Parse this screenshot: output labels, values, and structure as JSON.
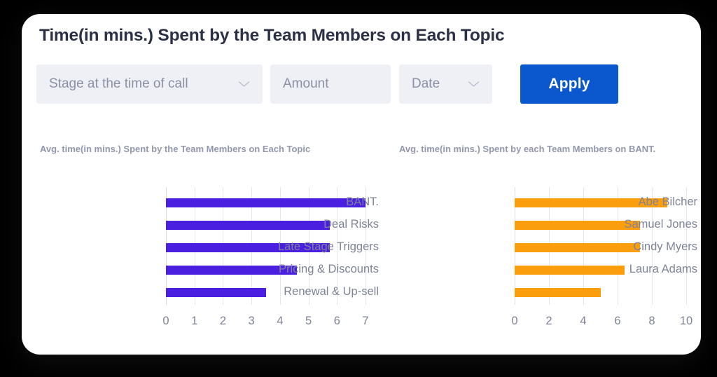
{
  "card": {
    "title": "Time(in mins.) Spent by the Team Members on Each Topic"
  },
  "filters": {
    "stage": {
      "label": "Stage at the time of call",
      "icon": "chevron-down-icon"
    },
    "amount": {
      "label": "Amount"
    },
    "date": {
      "label": "Date",
      "icon": "chevron-down-icon"
    },
    "apply_label": "Apply"
  },
  "colors": {
    "accent_blue": "#0b57ce",
    "bar_purple": "#4a1fe0",
    "bar_orange": "#fb9e0e",
    "field_bg": "#eef0f5",
    "title": "#2c3045",
    "muted_text": "#7e8398",
    "subtitle": "#9397ad",
    "gridline": "#e4e6ec",
    "card_bg": "#ffffff",
    "page_bg": "#000000"
  },
  "chart_data": [
    {
      "type": "bar",
      "orientation": "horizontal",
      "id": "avg-time-by-topic",
      "title": "Avg. time(in mins.) Spent by the Team Members on Each Topic",
      "categories": [
        "BANT.",
        "Deal Risks",
        "Late Stage Triggers",
        "Pricing & Discounts",
        "Renewal & Up-sell"
      ],
      "values": [
        7.0,
        5.75,
        5.75,
        4.6,
        3.5
      ],
      "series": [
        {
          "name": "Avg. time (mins)",
          "values": [
            7.0,
            5.75,
            5.75,
            4.6,
            3.5
          ],
          "color": "#4a1fe0"
        }
      ],
      "xlabel": "",
      "ylabel": "",
      "xlim": [
        0,
        7
      ],
      "xticks": [
        0,
        1,
        2,
        3,
        4,
        5,
        6,
        7
      ],
      "xticklabels": [
        "0",
        "1",
        "2",
        "3",
        "4",
        "5",
        "6",
        "7"
      ],
      "grid": true,
      "legend": false
    },
    {
      "type": "bar",
      "orientation": "horizontal",
      "id": "avg-time-on-bant",
      "title": "Avg. time(in mins.) Spent by each Team Members on BANT.",
      "categories": [
        "Abe Bilcher",
        "Samuel Jones",
        "Cindy Myers",
        "Laura Adams",
        ""
      ],
      "values": [
        8.9,
        7.3,
        7.3,
        6.4,
        5.0
      ],
      "series": [
        {
          "name": "Avg. time (mins)",
          "values": [
            8.9,
            7.3,
            7.3,
            6.4,
            5.0
          ],
          "color": "#fb9e0e"
        }
      ],
      "xlabel": "",
      "ylabel": "",
      "xlim": [
        0,
        10
      ],
      "xticks": [
        0,
        2,
        4,
        6,
        8,
        10
      ],
      "xticklabels": [
        "0",
        "2",
        "4",
        "6",
        "8",
        "10"
      ],
      "grid": true,
      "legend": false
    }
  ]
}
